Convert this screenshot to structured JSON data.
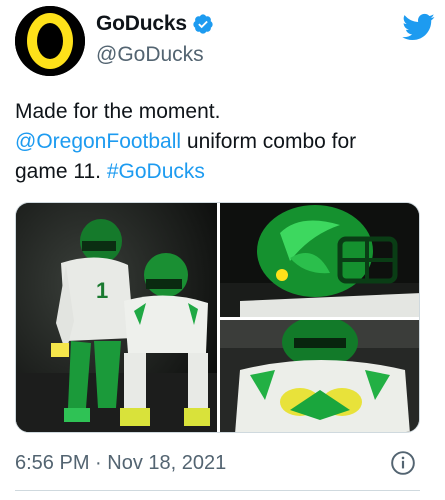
{
  "user": {
    "display_name": "GoDucks",
    "handle": "@GoDucks",
    "verified": true,
    "avatar_icon": "oregon-o-logo",
    "avatar_colors": {
      "background": "#000000",
      "ring": "#fee11a",
      "center": "#000000"
    }
  },
  "app_icon": "twitter-bird-icon",
  "colors": {
    "link": "#1d9bf0",
    "secondary_text": "#536471",
    "verified_badge": "#1d9bf0",
    "border": "#cfd9de"
  },
  "tweet": {
    "line1": "Made for the moment.",
    "mention": "@OregonFootball",
    "line2_rest": " uniform combo for",
    "line3_prefix": "game 11. ",
    "hashtag": "#GoDucks"
  },
  "media": [
    {
      "name": "two-players-uniform-photo"
    },
    {
      "name": "helmet-side-closeup-photo"
    },
    {
      "name": "player-gloves-wing-photo"
    }
  ],
  "timestamp": "6:56 PM · Nov 18, 2021",
  "info_icon": "info-icon"
}
